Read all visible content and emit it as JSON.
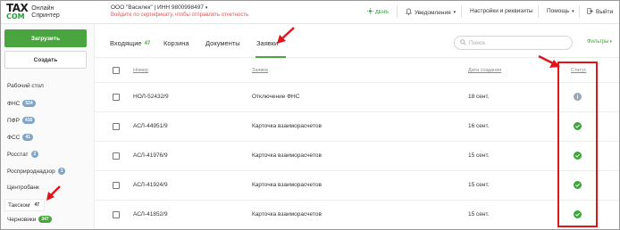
{
  "header": {
    "logo_top": "TAX",
    "logo_bottom": "COM",
    "logo_text_1": "Онлайн",
    "logo_text_2": "Спринтер",
    "org": "ООО \"Василек\" | ИНН 9800998497",
    "warning": "Войдите по сертификату, чтобы отправлять отчетность",
    "day_label": "ДЕНЬ",
    "notifications": "Уведомления",
    "settings": "Настройки и реквизиты",
    "help": "Помощь",
    "exit": "Выйти"
  },
  "sidebar": {
    "upload_label": "Загрузить",
    "create_label": "Создать",
    "items": [
      {
        "label": "Рабочий стол",
        "badge": ""
      },
      {
        "label": "ФНС",
        "badge": "524"
      },
      {
        "label": "ПФР",
        "badge": "416"
      },
      {
        "label": "ФСС",
        "badge": "41"
      },
      {
        "label": "Росстат",
        "badge": "2"
      },
      {
        "label": "Росприроднадзор",
        "badge": "1"
      },
      {
        "label": "Центробанк",
        "badge": ""
      },
      {
        "label": "Такском",
        "badge": "47"
      },
      {
        "label": "Черновики",
        "badge": "347"
      }
    ]
  },
  "tabs": [
    {
      "label": "Входящие",
      "count": "47"
    },
    {
      "label": "Корзина",
      "count": ""
    },
    {
      "label": "Документы",
      "count": ""
    },
    {
      "label": "Заявки",
      "count": ""
    }
  ],
  "search": {
    "placeholder": "Поиск"
  },
  "filters_label": "Фильтры",
  "table": {
    "columns": [
      "Номер",
      "Заявка",
      "Дата создания",
      "Статус"
    ],
    "rows": [
      {
        "number": "НОЛ-52432/9",
        "request": "Отключение ФНС",
        "date": "18 сент.",
        "status": "info"
      },
      {
        "number": "АСЛ-44951/9",
        "request": "Карточка взаиморасчетов",
        "date": "16 сент.",
        "status": "ok"
      },
      {
        "number": "АСЛ-41976/9",
        "request": "Карточка взаиморасчетов",
        "date": "15 сент.",
        "status": "ok"
      },
      {
        "number": "АСЛ-41924/9",
        "request": "Карточка взаиморасчетов",
        "date": "15 сент.",
        "status": "ok"
      },
      {
        "number": "АСЛ-41852/9",
        "request": "Карточка взаиморасчетов",
        "date": "15 сент.",
        "status": "ok"
      }
    ]
  },
  "colors": {
    "accent": "#4aa43f",
    "annotation": "#e0151a",
    "badge": "#7fa6c8"
  }
}
